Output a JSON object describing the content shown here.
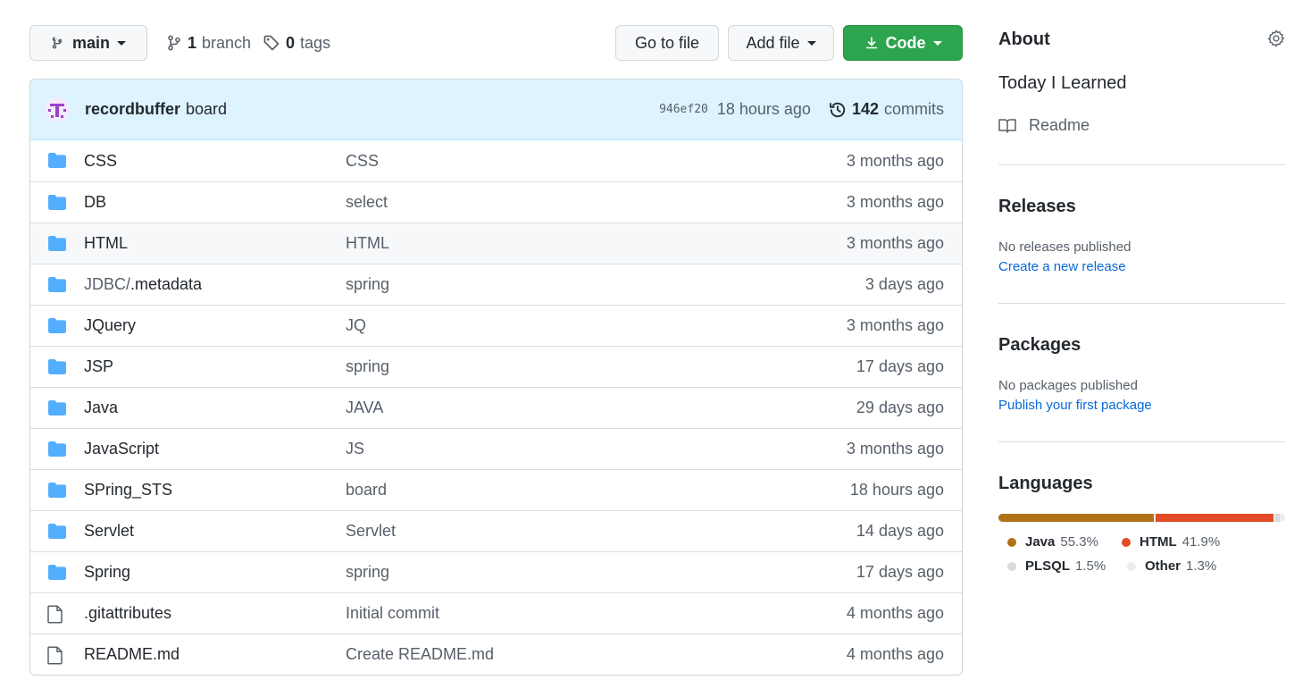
{
  "toolbar": {
    "branch_name": "main",
    "branch_count": "1",
    "branch_label": "branch",
    "tag_count": "0",
    "tag_label": "tags",
    "goto_label": "Go to file",
    "add_file_label": "Add file",
    "code_label": "Code"
  },
  "commit": {
    "author": "recordbuffer",
    "message": "board",
    "sha": "946ef20",
    "time": "18 hours ago",
    "count": "142",
    "count_label": "commits"
  },
  "files": [
    {
      "type": "dir",
      "name": "CSS",
      "name_suffix": "",
      "message": "CSS",
      "age": "3 months ago"
    },
    {
      "type": "dir",
      "name": "DB",
      "name_suffix": "",
      "message": "select",
      "age": "3 months ago"
    },
    {
      "type": "dir",
      "name": "HTML",
      "name_suffix": "",
      "message": "HTML",
      "age": "3 months ago"
    },
    {
      "type": "dir",
      "name": "JDBC/",
      "name_suffix": ".metadata",
      "message": "spring",
      "age": "3 days ago"
    },
    {
      "type": "dir",
      "name": "JQuery",
      "name_suffix": "",
      "message": "JQ",
      "age": "3 months ago"
    },
    {
      "type": "dir",
      "name": "JSP",
      "name_suffix": "",
      "message": "spring",
      "age": "17 days ago"
    },
    {
      "type": "dir",
      "name": "Java",
      "name_suffix": "",
      "message": "JAVA",
      "age": "29 days ago"
    },
    {
      "type": "dir",
      "name": "JavaScript",
      "name_suffix": "",
      "message": "JS",
      "age": "3 months ago"
    },
    {
      "type": "dir",
      "name": "SPring_STS",
      "name_suffix": "",
      "message": "board",
      "age": "18 hours ago"
    },
    {
      "type": "dir",
      "name": "Servlet",
      "name_suffix": "",
      "message": "Servlet",
      "age": "14 days ago"
    },
    {
      "type": "dir",
      "name": "Spring",
      "name_suffix": "",
      "message": "spring",
      "age": "17 days ago"
    },
    {
      "type": "file",
      "name": ".gitattributes",
      "name_suffix": "",
      "message": "Initial commit",
      "age": "4 months ago"
    },
    {
      "type": "file",
      "name": "README.md",
      "name_suffix": "",
      "message": "Create README.md",
      "age": "4 months ago"
    }
  ],
  "sidebar": {
    "about_title": "About",
    "description": "Today I Learned",
    "readme_label": "Readme",
    "releases_title": "Releases",
    "releases_note": "No releases published",
    "releases_link": "Create a new release",
    "packages_title": "Packages",
    "packages_note": "No packages published",
    "packages_link": "Publish your first package",
    "languages_title": "Languages",
    "languages": [
      {
        "name": "Java",
        "percent": "55.3%",
        "value": 55.3,
        "color": "#b07219"
      },
      {
        "name": "HTML",
        "percent": "41.9%",
        "value": 41.9,
        "color": "#e34c26"
      },
      {
        "name": "PLSQL",
        "percent": "1.5%",
        "value": 1.5,
        "color": "#dadadb"
      },
      {
        "name": "Other",
        "percent": "1.3%",
        "value": 1.3,
        "color": "#ededed"
      }
    ]
  },
  "colors": {
    "primary_button": "#2da44e",
    "link": "#0969da",
    "folder_icon": "#54aeff",
    "commit_bar": "#ddf4ff"
  }
}
